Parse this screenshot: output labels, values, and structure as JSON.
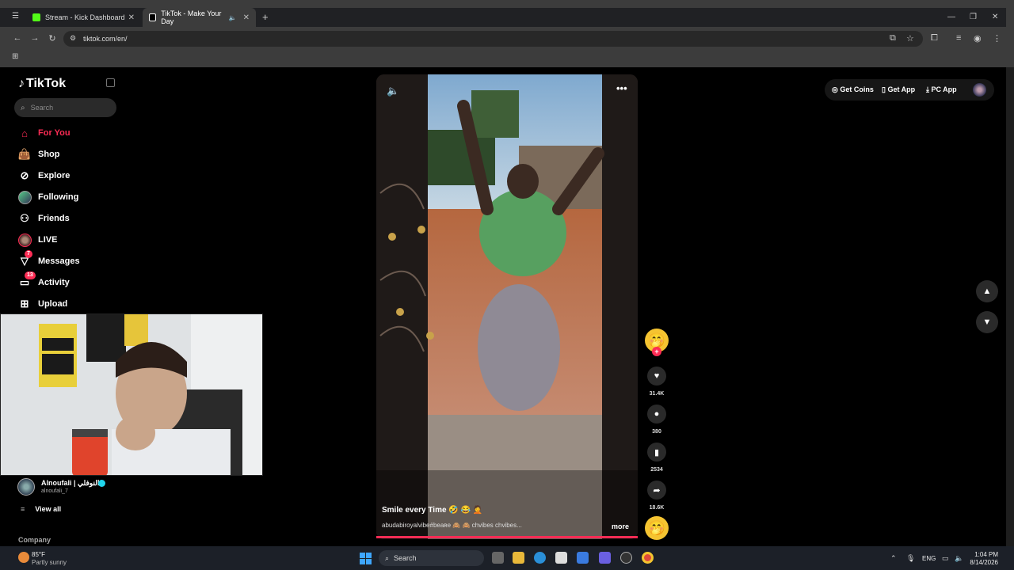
{
  "browser": {
    "tabs": [
      {
        "title": "Stream - Kick Dashboard",
        "active": false
      },
      {
        "title": "TikTok - Make Your Day",
        "active": true
      }
    ],
    "url": "tiktok.com/en/",
    "new_tab": "+"
  },
  "sidebar": {
    "logo": "TikTok",
    "search_placeholder": "Search",
    "items": [
      {
        "label": "For You",
        "icon": "home-icon",
        "active": true
      },
      {
        "label": "Shop",
        "icon": "shopping-bag-icon"
      },
      {
        "label": "Explore",
        "icon": "compass-icon"
      },
      {
        "label": "Following",
        "icon": "following-avatar-icon"
      },
      {
        "label": "Friends",
        "icon": "friends-icon"
      },
      {
        "label": "LIVE",
        "icon": "live-icon"
      },
      {
        "label": "Messages",
        "icon": "messages-icon",
        "badge": "7"
      },
      {
        "label": "Activity",
        "icon": "activity-icon",
        "badge": "13"
      },
      {
        "label": "Upload",
        "icon": "upload-icon"
      }
    ],
    "following_account": {
      "name": "Alnoufali | النوفلي",
      "handle": "alnoufali_7",
      "verified": true
    },
    "view_all": "View all",
    "company": "Company"
  },
  "topbar": {
    "get_coins": "Get Coins",
    "get_app": "Get App",
    "pc_app": "PC App"
  },
  "video": {
    "caption": "Smile every Time 🤣 😂 🤦",
    "hashtags": "abudabiroyalvibe#beaʀe 🙈 🙈 chvibes chvibes...",
    "more": "more",
    "likes": "31.4K",
    "comments": "380",
    "bookmarks": "2534",
    "shares": "18.6K"
  },
  "taskbar": {
    "weather_temp": "85°F",
    "weather_desc": "Partly sunny",
    "search": "Search",
    "language": "ENG",
    "time": "1:04 PM",
    "date": "8/14/2026"
  },
  "colors": {
    "accent": "#fe2c55",
    "background": "#000000",
    "chrome": "#3c3c3c"
  }
}
